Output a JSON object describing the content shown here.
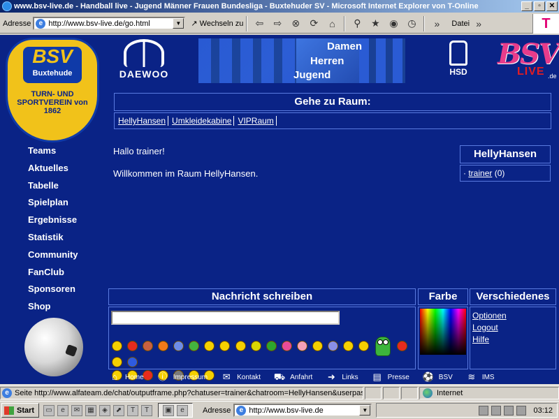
{
  "window": {
    "title": "www.bsv-live.de - Handball live - Jugend Männer Frauen Bundesliga - Buxtehuder SV - Microsoft Internet Explorer von T-Online",
    "buttons": {
      "minimize": "_",
      "maximize": "▫",
      "close": "✕"
    }
  },
  "toolbar": {
    "address_label": "Adresse",
    "url": "http://www.bsv-live.de/go.html",
    "go_label": "Wechseln zu",
    "file_menu": "Datei",
    "brand": "T"
  },
  "header": {
    "club_name": "BSV",
    "club_city": "Buxtehude",
    "club_ring": "TURN- UND SPORTVEREIN von 1862",
    "sponsor1": "DAEWOO",
    "banner_lines": [
      "Damen",
      "Herren",
      "Jugend"
    ],
    "sponsor2": "HSD",
    "live_logo": {
      "bsv": "BSV",
      "live": "LIVE",
      "tld": ".de"
    }
  },
  "rooms": {
    "heading": "Gehe zu Raum:",
    "links": [
      "HellyHansen",
      "Umkleidekabine",
      "VIPRaum"
    ]
  },
  "nav": {
    "items": [
      "Teams",
      "Aktuelles",
      "Tabelle",
      "Spielplan",
      "Ergebnisse",
      "Statistik",
      "Community",
      "FanClub",
      "Sponsoren",
      "Shop"
    ]
  },
  "chat": {
    "greeting": "Hallo trainer!",
    "welcome": "Willkommen im Raum HellyHansen."
  },
  "userlist": {
    "room": "HellyHansen",
    "bullet": "·",
    "user": "trainer",
    "count": "(0)"
  },
  "message": {
    "heading": "Nachricht schreiben",
    "value": "",
    "color_heading": "Farbe",
    "misc_heading": "Verschiedenes",
    "misc_links": [
      "Optionen",
      "Logout",
      "Hilfe"
    ]
  },
  "bottom_nav": [
    {
      "label": "Home",
      "icon": "home-icon"
    },
    {
      "label": "Impressum",
      "icon": "info-icon"
    },
    {
      "label": "Kontakt",
      "icon": "mail-icon"
    },
    {
      "label": "Anfahrt",
      "icon": "car-icon"
    },
    {
      "label": "Links",
      "icon": "arrow-icon"
    },
    {
      "label": "Presse",
      "icon": "newspaper-icon"
    },
    {
      "label": "BSV",
      "icon": "handball-icon"
    },
    {
      "label": "IMS",
      "icon": "ims-icon"
    }
  ],
  "statusbar": {
    "text": "Seite http://www.alfateam.de/chat/outputframe.php?chatuser=trainer&chatroom=HellyHansen&userpass=",
    "zone": "Internet"
  },
  "taskbar": {
    "start": "Start",
    "address_label": "Adresse",
    "address_url": "http://www.bsv-live.de",
    "clock": "03:12"
  }
}
